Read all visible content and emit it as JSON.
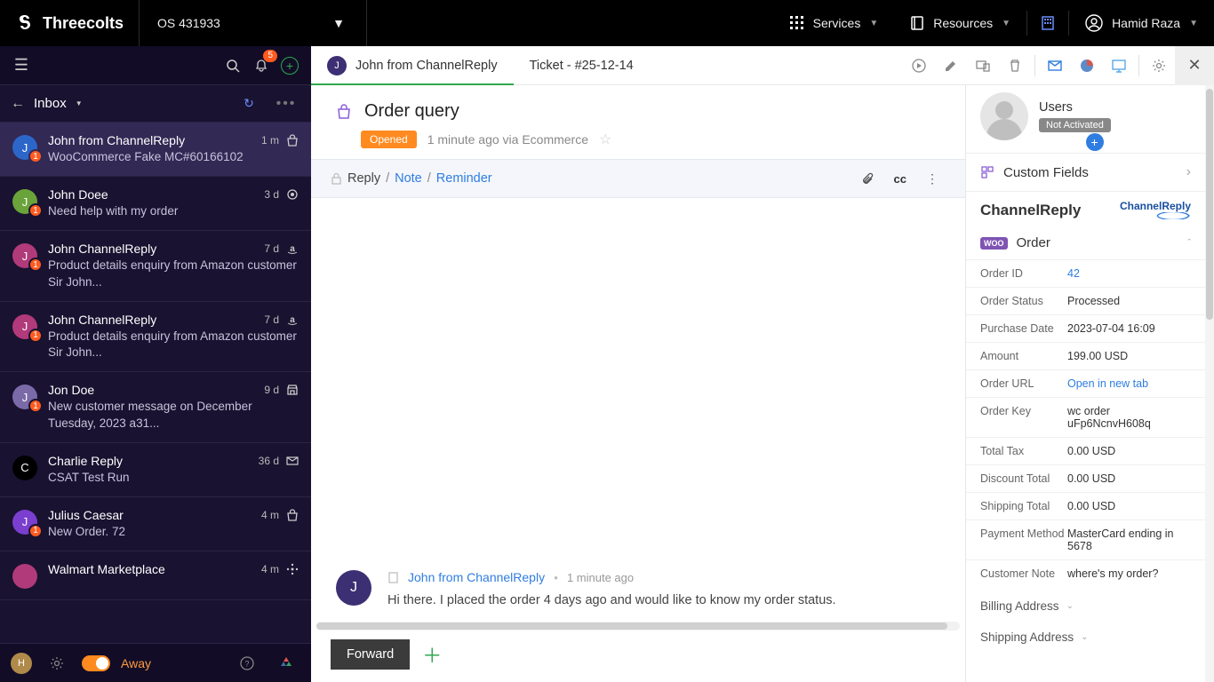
{
  "topbar": {
    "brand": "Threecolts",
    "os_label": "OS 431933",
    "services": "Services",
    "resources": "Resources",
    "user": "Hamid Raza"
  },
  "sidebar": {
    "bell_count": "5",
    "nav_label": "Inbox",
    "footer_avatar": "H",
    "footer_status": "Away"
  },
  "tickets": [
    {
      "avatar_letter": "J",
      "avatar_bg": "#2d66c9",
      "badge": "1",
      "name": "John from ChannelReply",
      "time": "1 m",
      "source_icon": "bag",
      "desc": "WooCommerce Fake MC#60166102",
      "active": true
    },
    {
      "avatar_letter": "J",
      "avatar_bg": "#6aa33a",
      "badge": "1",
      "name": "John Doee",
      "time": "3 d",
      "source_icon": "circle",
      "desc": "Need help with my order"
    },
    {
      "avatar_letter": "J",
      "avatar_bg": "#b13a7a",
      "badge": "1",
      "name": "John ChannelReply",
      "time": "7 d",
      "source_icon": "amazon",
      "desc": "Product details enquiry from Amazon customer Sir John..."
    },
    {
      "avatar_letter": "J",
      "avatar_bg": "#b13a7a",
      "badge": "1",
      "name": "John ChannelReply",
      "time": "7 d",
      "source_icon": "amazon",
      "desc": "Product details enquiry from Amazon customer Sir John..."
    },
    {
      "avatar_letter": "J",
      "avatar_bg": "#7a6aa8",
      "badge": "1",
      "name": "Jon Doe",
      "time": "9 d",
      "source_icon": "shop",
      "desc": "New customer message on December Tuesday, 2023 a31..."
    },
    {
      "avatar_letter": "C",
      "avatar_bg": "#000",
      "badge": "",
      "name": "Charlie Reply",
      "time": "36 d",
      "source_icon": "mail",
      "desc": "CSAT Test Run"
    },
    {
      "avatar_letter": "J",
      "avatar_bg": "#7a3fcf",
      "badge": "1",
      "name": "Julius Caesar",
      "time": "4 m",
      "source_icon": "bag",
      "desc": "New Order. 72"
    },
    {
      "avatar_letter": "",
      "avatar_bg": "#b13a7a",
      "badge": "",
      "name": "Walmart Marketplace",
      "time": "4 m",
      "source_icon": "spark",
      "desc": ""
    }
  ],
  "tabs": {
    "tab1_avatar": "J",
    "tab1_label": "John from ChannelReply",
    "tab2_label": "Ticket - #25-12-14"
  },
  "subject": {
    "text": "Order query",
    "status_pill": "Opened",
    "meta": "1 minute ago via Ecommerce"
  },
  "reply_bar": {
    "reply": "Reply",
    "slash1": " / ",
    "note": "Note",
    "slash2": " / ",
    "reminder": "Reminder",
    "cc": "cc"
  },
  "message": {
    "avatar": "J",
    "name": "John from ChannelReply",
    "when": "1 minute ago",
    "text": "Hi there. I placed the order 4 days ago and would like to know my order status."
  },
  "footer": {
    "forward": "Forward"
  },
  "right": {
    "user_name": "Users",
    "user_status": "Not Activated",
    "custom_fields": "Custom Fields",
    "cr_title": "ChannelReply",
    "cr_logo_a": "Channel",
    "cr_logo_b": "Reply",
    "order_label": "Order",
    "fields": [
      {
        "k": "Order ID",
        "v": "42",
        "link": true
      },
      {
        "k": "Order Status",
        "v": "Processed"
      },
      {
        "k": "Purchase Date",
        "v": "2023-07-04 16:09"
      },
      {
        "k": "Amount",
        "v": "199.00 USD"
      },
      {
        "k": "Order URL",
        "v": "Open in new tab",
        "link": true
      },
      {
        "k": "Order Key",
        "v": "wc order uFp6NcnvH608q"
      },
      {
        "k": "Total Tax",
        "v": "0.00 USD"
      },
      {
        "k": "Discount Total",
        "v": "0.00 USD"
      },
      {
        "k": "Shipping Total",
        "v": "0.00 USD"
      },
      {
        "k": "Payment Method",
        "v": "MasterCard ending in 5678"
      },
      {
        "k": "Customer Note",
        "v": "where's my order?"
      }
    ],
    "billing": "Billing Address",
    "shipping": "Shipping Address"
  }
}
